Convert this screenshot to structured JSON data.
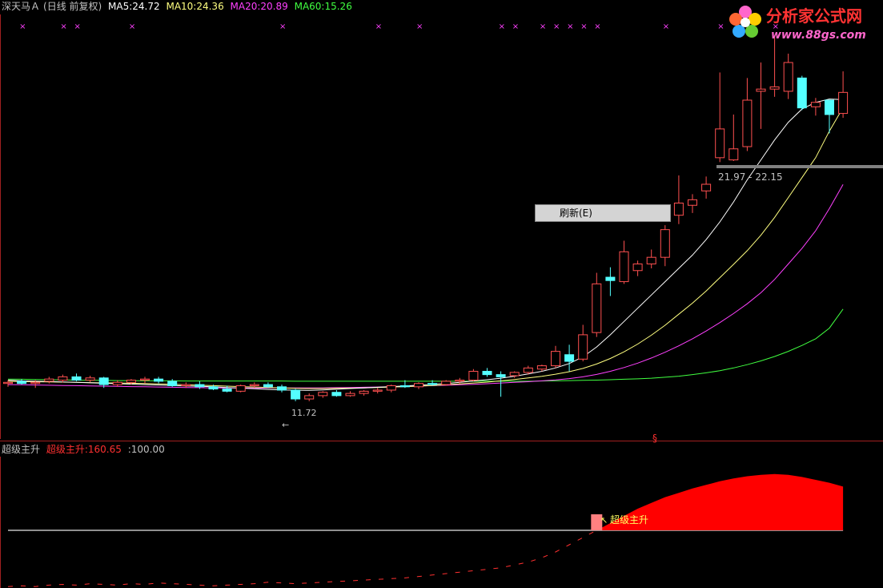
{
  "header": {
    "stock": "深天马Ａ",
    "period": "(日线 前复权)",
    "ma5_label": "MA5:",
    "ma5_value": "24.72",
    "ma10_label": "MA10:",
    "ma10_value": "24.36",
    "ma20_label": "MA20:",
    "ma20_value": "20.89",
    "ma60_label": "MA60:",
    "ma60_value": "15.26"
  },
  "sub_header": {
    "indicator": "超级主升",
    "line_label": "超级主升:",
    "line_value": "160.65",
    "ref_label": ":",
    "ref_value": "100.00"
  },
  "context_menu": {
    "refresh": "刷新(E)"
  },
  "watermark": {
    "title": "分析家公式网",
    "url": "www.88gs.com"
  },
  "annotations": {
    "low_price": "11.72",
    "crosshair_range": "21.97 - 22.15",
    "signal_label": "超级主升",
    "signal_marker": "§"
  },
  "colors": {
    "up": "#ff5050",
    "down": "#54ffff",
    "ma5": "#ffffff",
    "ma10": "#ffff80",
    "ma20": "#ff40ff",
    "ma60": "#40ff40",
    "header_label": "#c0c0c0",
    "indicator": "#ff3030",
    "ref_line": "#c0c0c0",
    "marker": "#ff40ff"
  },
  "chart_data": [
    {
      "type": "candlestick",
      "ylim": [
        9.5,
        28.5
      ],
      "candles": [
        [
          11.9,
          12.05,
          11.75,
          11.95
        ],
        [
          12.0,
          12.1,
          11.85,
          11.9
        ],
        [
          11.9,
          12.05,
          11.7,
          11.95
        ],
        [
          12.0,
          12.2,
          11.9,
          12.1
        ],
        [
          12.05,
          12.3,
          11.95,
          12.2
        ],
        [
          12.2,
          12.35,
          12.0,
          12.05
        ],
        [
          12.05,
          12.25,
          11.95,
          12.15
        ],
        [
          12.15,
          12.2,
          11.7,
          11.85
        ],
        [
          11.85,
          12.05,
          11.75,
          11.95
        ],
        [
          11.95,
          12.1,
          11.85,
          12.05
        ],
        [
          12.05,
          12.2,
          11.9,
          12.1
        ],
        [
          12.1,
          12.2,
          11.9,
          12.0
        ],
        [
          12.0,
          12.1,
          11.75,
          11.8
        ],
        [
          11.8,
          11.95,
          11.7,
          11.85
        ],
        [
          11.85,
          12.0,
          11.65,
          11.75
        ],
        [
          11.75,
          11.85,
          11.6,
          11.65
        ],
        [
          11.65,
          11.8,
          11.5,
          11.55
        ],
        [
          11.55,
          11.85,
          11.5,
          11.8
        ],
        [
          11.8,
          11.95,
          11.7,
          11.85
        ],
        [
          11.85,
          11.95,
          11.7,
          11.75
        ],
        [
          11.75,
          11.85,
          11.5,
          11.6
        ],
        [
          11.6,
          11.65,
          11.1,
          11.2
        ],
        [
          11.2,
          11.45,
          11.1,
          11.35
        ],
        [
          11.35,
          11.55,
          11.25,
          11.5
        ],
        [
          11.5,
          11.6,
          11.3,
          11.35
        ],
        [
          11.35,
          11.55,
          11.3,
          11.45
        ],
        [
          11.45,
          11.6,
          11.35,
          11.55
        ],
        [
          11.55,
          11.7,
          11.45,
          11.6
        ],
        [
          11.6,
          11.85,
          11.5,
          11.8
        ],
        [
          11.8,
          12.05,
          11.7,
          11.75
        ],
        [
          11.75,
          11.95,
          11.65,
          11.9
        ],
        [
          11.9,
          12.05,
          11.8,
          11.85
        ],
        [
          11.85,
          12.05,
          11.8,
          12.0
        ],
        [
          12.0,
          12.15,
          11.9,
          12.05
        ],
        [
          12.05,
          12.55,
          12.0,
          12.45
        ],
        [
          12.45,
          12.6,
          12.2,
          12.3
        ],
        [
          12.3,
          12.45,
          11.3,
          12.2
        ],
        [
          12.25,
          12.45,
          12.15,
          12.4
        ],
        [
          12.4,
          12.7,
          12.3,
          12.6
        ],
        [
          12.55,
          12.75,
          12.45,
          12.7
        ],
        [
          12.7,
          13.6,
          12.6,
          13.35
        ],
        [
          13.2,
          13.65,
          12.45,
          12.9
        ],
        [
          13.0,
          14.55,
          12.9,
          14.1
        ],
        [
          14.2,
          16.9,
          14.0,
          16.4
        ],
        [
          16.7,
          17.15,
          15.85,
          16.55
        ],
        [
          16.5,
          18.35,
          16.4,
          17.85
        ],
        [
          17.0,
          17.45,
          16.75,
          17.3
        ],
        [
          17.3,
          17.95,
          17.1,
          17.6
        ],
        [
          17.6,
          19.05,
          17.2,
          18.85
        ],
        [
          19.5,
          21.3,
          19.1,
          20.05
        ],
        [
          19.95,
          20.45,
          19.6,
          20.2
        ],
        [
          20.6,
          21.25,
          20.25,
          20.9
        ],
        [
          22.1,
          25.95,
          21.9,
          23.4
        ],
        [
          22.0,
          24.05,
          21.95,
          22.5
        ],
        [
          22.6,
          25.7,
          22.4,
          24.7
        ],
        [
          25.1,
          26.4,
          23.4,
          25.2
        ],
        [
          25.2,
          27.6,
          24.85,
          25.3
        ],
        [
          25.1,
          26.8,
          24.75,
          26.4
        ],
        [
          25.7,
          25.8,
          24.25,
          24.35
        ],
        [
          24.4,
          24.8,
          24.0,
          24.6
        ],
        [
          24.7,
          24.7,
          23.2,
          24.05
        ],
        [
          24.1,
          26.0,
          23.9,
          25.05
        ]
      ],
      "ma5": [
        12.05,
        12.02,
        12.0,
        11.99,
        11.97,
        11.95,
        11.93,
        11.91,
        11.89,
        11.87,
        11.85,
        11.83,
        11.81,
        11.79,
        11.77,
        11.75,
        11.72,
        11.69,
        11.66,
        11.63,
        11.61,
        11.6,
        11.59,
        11.61,
        11.64,
        11.67,
        11.7,
        11.73,
        11.76,
        11.79,
        11.82,
        11.86,
        11.9,
        11.95,
        12.01,
        12.07,
        12.14,
        12.23,
        12.33,
        12.45,
        12.6,
        12.8,
        13.1,
        13.55,
        14.1,
        14.7,
        15.3,
        15.9,
        16.5,
        17.1,
        17.7,
        18.4,
        19.2,
        20.1,
        21.1,
        22.0,
        22.9,
        23.7,
        24.3,
        24.6,
        24.75,
        24.72
      ],
      "ma10": [
        12.0,
        11.99,
        11.98,
        11.97,
        11.96,
        11.95,
        11.94,
        11.93,
        11.92,
        11.91,
        11.9,
        11.88,
        11.86,
        11.84,
        11.82,
        11.8,
        11.78,
        11.76,
        11.74,
        11.72,
        11.7,
        11.68,
        11.67,
        11.67,
        11.68,
        11.69,
        11.7,
        11.72,
        11.74,
        11.76,
        11.78,
        11.81,
        11.84,
        11.88,
        11.92,
        11.96,
        12.02,
        12.08,
        12.15,
        12.22,
        12.32,
        12.43,
        12.58,
        12.78,
        13.03,
        13.33,
        13.68,
        14.08,
        14.53,
        15.03,
        15.53,
        16.08,
        16.68,
        17.28,
        17.9,
        18.6,
        19.4,
        20.3,
        21.2,
        22.1,
        23.3,
        24.36
      ],
      "ma20": [
        11.85,
        11.84,
        11.83,
        11.82,
        11.81,
        11.8,
        11.79,
        11.78,
        11.77,
        11.76,
        11.75,
        11.74,
        11.73,
        11.72,
        11.71,
        11.7,
        11.7,
        11.7,
        11.7,
        11.7,
        11.7,
        11.7,
        11.7,
        11.7,
        11.71,
        11.72,
        11.73,
        11.74,
        11.75,
        11.76,
        11.78,
        11.8,
        11.82,
        11.84,
        11.86,
        11.89,
        11.92,
        11.95,
        11.98,
        12.02,
        12.06,
        12.12,
        12.2,
        12.31,
        12.45,
        12.62,
        12.82,
        13.05,
        13.31,
        13.6,
        13.92,
        14.27,
        14.65,
        15.06,
        15.5,
        16.0,
        16.6,
        17.3,
        18.0,
        18.8,
        19.8,
        20.89
      ],
      "ma60": [
        12.1,
        12.09,
        12.08,
        12.07,
        12.06,
        12.05,
        12.04,
        12.04,
        12.03,
        12.03,
        12.02,
        12.02,
        12.02,
        12.01,
        12.01,
        12.01,
        12.01,
        12.01,
        12.01,
        12.01,
        12.01,
        12.0,
        12.0,
        12.0,
        12.0,
        12.0,
        12.0,
        12.0,
        12.0,
        12.0,
        12.0,
        12.0,
        12.0,
        12.0,
        12.0,
        12.0,
        12.0,
        12.0,
        12.0,
        12.01,
        12.02,
        12.03,
        12.04,
        12.05,
        12.07,
        12.09,
        12.11,
        12.14,
        12.18,
        12.23,
        12.3,
        12.38,
        12.48,
        12.6,
        12.75,
        12.92,
        13.12,
        13.35,
        13.62,
        13.92,
        14.4,
        15.26
      ]
    },
    {
      "type": "area",
      "ylim": [
        20,
        200
      ],
      "reference_line": 100,
      "signal_index": 43,
      "values": [
        22,
        23,
        22,
        24,
        25,
        24,
        26,
        25,
        24,
        26,
        25,
        27,
        26,
        25,
        24,
        23,
        24,
        25,
        26,
        28,
        27,
        26,
        27,
        28,
        29,
        30,
        31,
        32,
        33,
        34,
        36,
        38,
        40,
        42,
        44,
        46,
        48,
        52,
        56,
        62,
        70,
        80,
        90,
        100,
        110,
        120,
        130,
        138,
        146,
        152,
        158,
        163,
        168,
        172,
        175,
        177,
        178,
        177,
        174,
        170,
        166,
        160.65
      ]
    }
  ]
}
